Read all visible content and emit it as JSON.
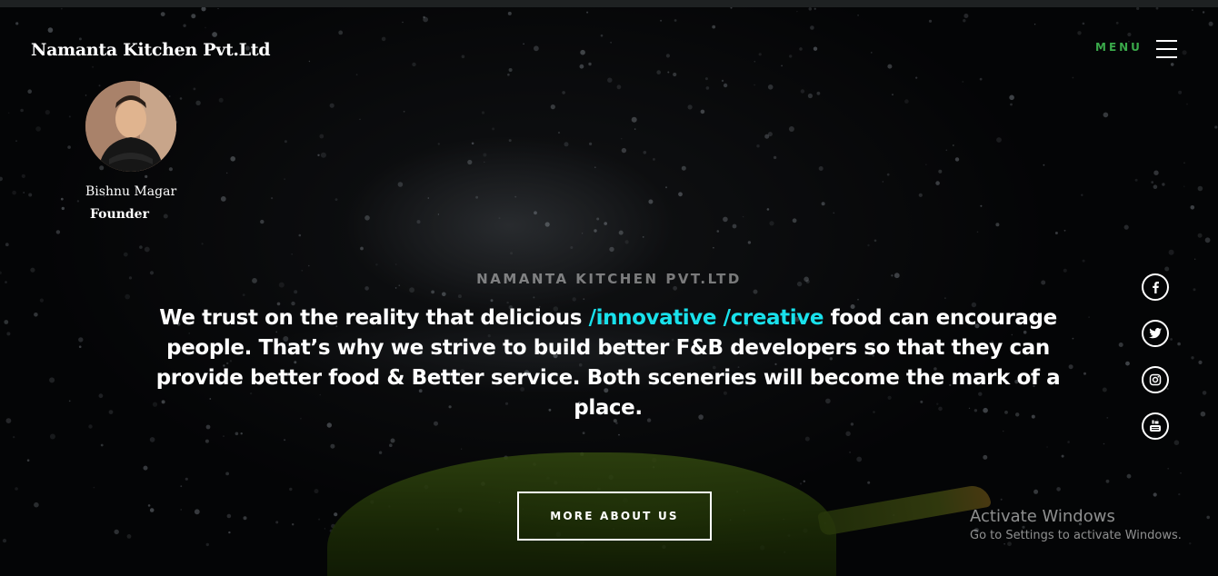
{
  "header": {
    "brand": "Namanta Kitchen Pvt.Ltd",
    "menu_label": "MENU"
  },
  "founder": {
    "name": "Bishnu Magar",
    "role": "Founder"
  },
  "hero": {
    "eyebrow": "NAMANTA KITCHEN PVT.LTD",
    "headline_part1": "We trust on the reality that delicious ",
    "headline_highlight": "/innovative /creative",
    "headline_part2": " food can encourage people. That’s why we strive to build better F&B developers so that they can provide better food & Better service. Both sceneries will become the mark of a place.",
    "cta_label": "MORE ABOUT US"
  },
  "social": [
    {
      "name": "facebook-icon"
    },
    {
      "name": "twitter-icon"
    },
    {
      "name": "instagram-icon"
    },
    {
      "name": "youtube-icon"
    }
  ],
  "watermark": {
    "title": "Activate Windows",
    "subtitle": "Go to Settings to activate Windows."
  },
  "colors": {
    "menu_accent": "#3aa94a",
    "highlight": "#19e1ec",
    "background": "#0c0d0f"
  }
}
